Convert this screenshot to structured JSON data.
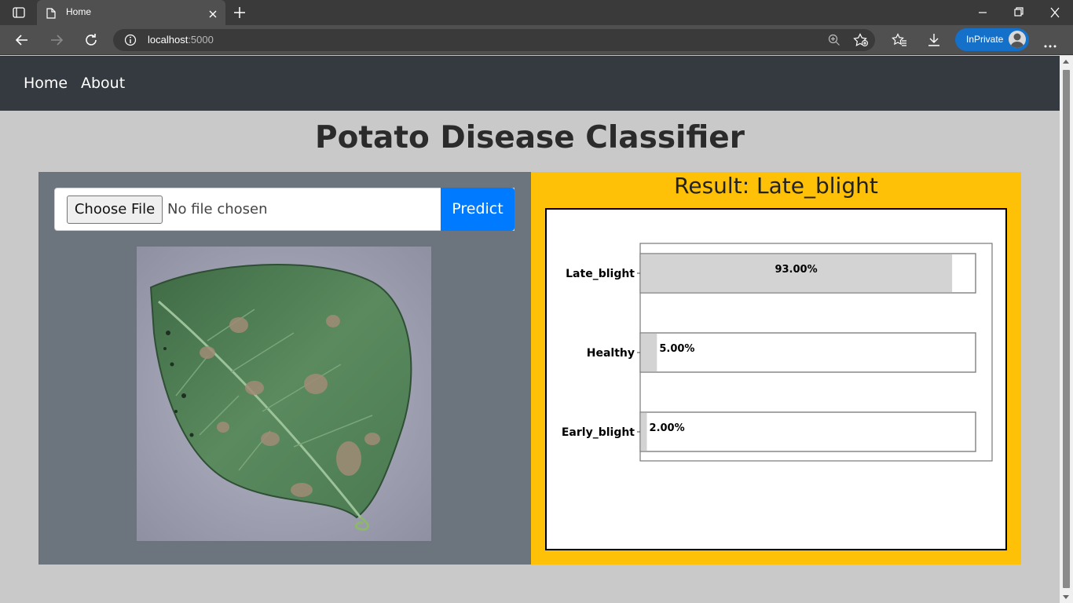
{
  "browser": {
    "tab_title": "Home",
    "url_host": "localhost",
    "url_port": ":5000",
    "inprivate_label": "InPrivate"
  },
  "navbar": {
    "links": [
      "Home",
      "About"
    ]
  },
  "page": {
    "heading": "Potato Disease Classifier",
    "choose_file_label": "Choose File",
    "no_file_text": "No file chosen",
    "predict_label": "Predict",
    "result_text": "Result: Late_blight"
  },
  "colors": {
    "navbar": "#343a40",
    "left_panel": "#6c757d",
    "right_panel": "#ffc107",
    "predict_button": "#007bff",
    "bar_fill": "#d3d3d3"
  },
  "chart_data": {
    "type": "bar",
    "orientation": "horizontal",
    "categories": [
      "Late_blight",
      "Healthy",
      "Early_blight"
    ],
    "values": [
      93.0,
      5.0,
      2.0
    ],
    "value_labels": [
      "93.00%",
      "5.00%",
      "2.00%"
    ],
    "xlim": [
      0,
      100
    ],
    "title": "",
    "xlabel": "",
    "ylabel": "",
    "grid": false
  }
}
